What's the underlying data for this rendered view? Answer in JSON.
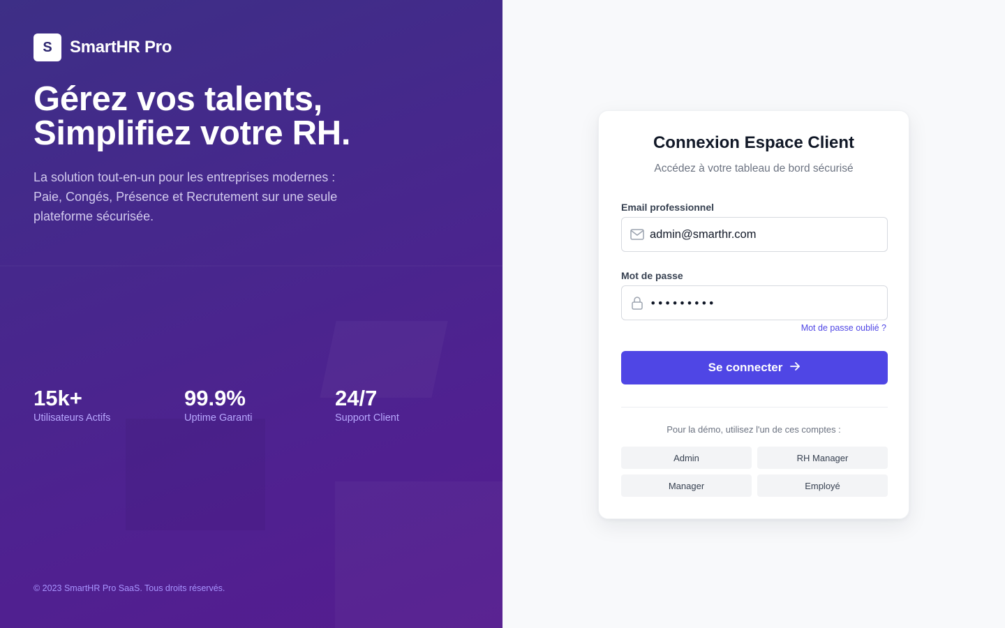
{
  "brand": {
    "logo_letter": "S",
    "name": "SmartHR Pro"
  },
  "hero": {
    "title_line1": "Gérez vos talents,",
    "title_line2": "Simplifiez votre RH.",
    "subtitle": "La solution tout-en-un pour les entreprises modernes : Paie, Congés, Présence et Recrutement sur une seule plateforme sécurisée."
  },
  "stats": [
    {
      "value": "15k+",
      "label": "Utilisateurs Actifs"
    },
    {
      "value": "99.9%",
      "label": "Uptime Garanti"
    },
    {
      "value": "24/7",
      "label": "Support Client"
    }
  ],
  "footer": {
    "copyright": "© 2023 SmartHR Pro SaaS. Tous droits réservés."
  },
  "login": {
    "title": "Connexion Espace Client",
    "subtitle": "Accédez à votre tableau de bord sécurisé",
    "email_label": "Email professionnel",
    "email_value": "admin@smarthr.com",
    "email_icon": "mail-icon",
    "password_label": "Mot de passe",
    "password_value": "•••••••••",
    "password_icon": "lock-icon",
    "forgot_label": "Mot de passe oublié ?",
    "submit_label": "Se connecter",
    "submit_icon": "arrow-right-icon",
    "demo_note": "Pour la démo, utilisez l'un de ces comptes :",
    "demo_accounts": [
      "Admin",
      "RH Manager",
      "Manager",
      "Employé"
    ]
  },
  "colors": {
    "accent": "#4f46e5",
    "left_gradient_start": "#3d2f86",
    "left_gradient_end": "#551c8f",
    "stat_label": "#b8a8ff"
  }
}
